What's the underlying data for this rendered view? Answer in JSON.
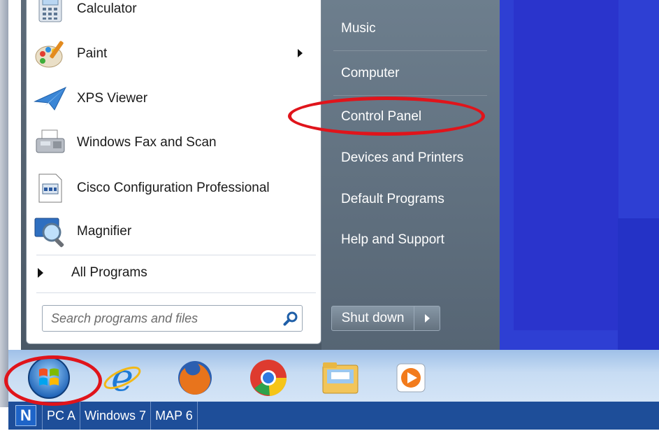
{
  "start_menu": {
    "programs": [
      {
        "label": "Calculator",
        "icon": "calculator-icon",
        "has_submenu": false
      },
      {
        "label": "Paint",
        "icon": "paint-icon",
        "has_submenu": true
      },
      {
        "label": "XPS Viewer",
        "icon": "xps-viewer-icon",
        "has_submenu": false
      },
      {
        "label": "Windows Fax and Scan",
        "icon": "fax-scan-icon",
        "has_submenu": false
      },
      {
        "label": "Cisco Configuration Professional",
        "icon": "cisco-ccp-icon",
        "has_submenu": false
      },
      {
        "label": "Magnifier",
        "icon": "magnifier-icon",
        "has_submenu": false
      }
    ],
    "all_programs_label": "All Programs",
    "search_placeholder": "Search programs and files",
    "right_items": [
      "Music",
      "Computer",
      "Control Panel",
      "Devices and Printers",
      "Default Programs",
      "Help and Support"
    ],
    "shutdown_label": "Shut down"
  },
  "taskbar": {
    "pinned": [
      "windows-start-orb",
      "internet-explorer-icon",
      "firefox-icon",
      "chrome-icon",
      "windows-explorer-icon",
      "media-player-icon"
    ]
  },
  "vm_bar": {
    "logo_letter": "N",
    "tabs": [
      "PC A",
      "Windows 7",
      "MAP 6"
    ]
  },
  "colors": {
    "annotation": "#e0141b",
    "desktop": "#2e3fd3",
    "taskbar": "#c7dcf3"
  }
}
